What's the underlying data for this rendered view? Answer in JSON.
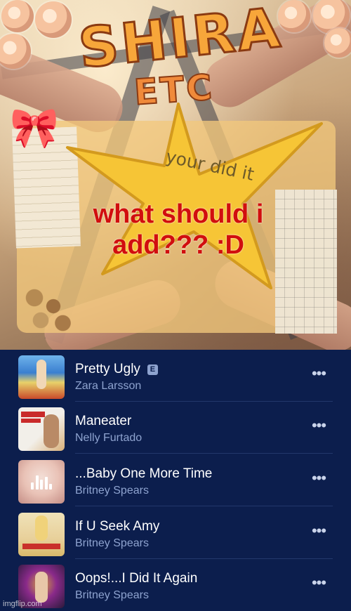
{
  "meme": {
    "title_main": "SHIRA",
    "title_sub": "ETC",
    "star_text": "your did it",
    "caption": "what should i add??? :D"
  },
  "tracks": [
    {
      "title": "Pretty Ugly",
      "explicit_badge": "E",
      "artist": "Zara Larsson",
      "more_icon": "ellipsis-icon",
      "art_colors": [
        "#3a7fd0",
        "#e8d26a",
        "#c94a2a"
      ]
    },
    {
      "title": "Maneater",
      "artist": "Nelly Furtado",
      "more_icon": "ellipsis-icon",
      "art_colors": [
        "#f2efe9",
        "#c92a2a",
        "#d9b07a"
      ]
    },
    {
      "title": "...Baby One More Time",
      "artist": "Britney Spears",
      "more_icon": "ellipsis-icon",
      "now_playing": true,
      "art_colors": [
        "#e9c2b6",
        "#c48d85",
        "#f3ded6"
      ]
    },
    {
      "title": "If U Seek Amy",
      "artist": "Britney Spears",
      "more_icon": "ellipsis-icon",
      "art_colors": [
        "#efe2b8",
        "#d9b96a",
        "#c9302a"
      ]
    },
    {
      "title": "Oops!...I Did It Again",
      "artist": "Britney Spears",
      "more_icon": "ellipsis-icon",
      "art_colors": [
        "#2a1a3a",
        "#d9a83a",
        "#8a2a8a"
      ]
    }
  ],
  "watermark": "imgflip.com",
  "colors": {
    "list_background": "#0c1e4d",
    "title_text": "#ffffff",
    "artist_text": "#8ea3cf",
    "caption_red": "#d10e0e",
    "star_yellow": "#f6c536"
  }
}
